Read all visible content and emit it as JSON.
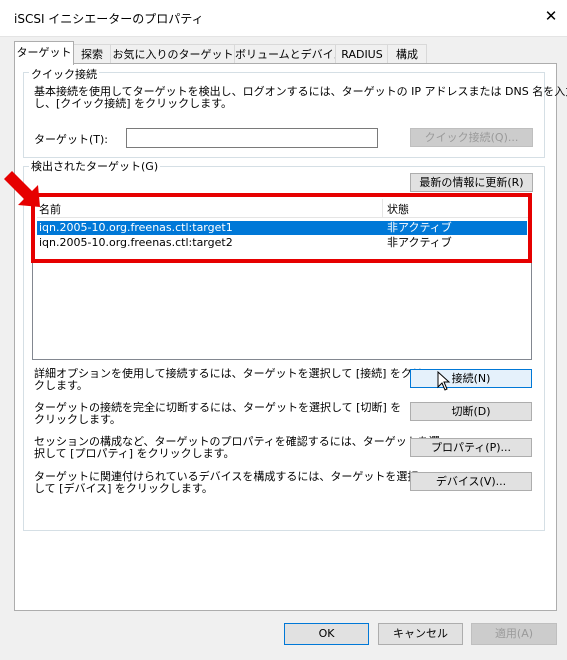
{
  "window": {
    "title": "iSCSI イニシエーターのプロパティ",
    "close_glyph": "✕"
  },
  "tabs": [
    {
      "label": "ターゲット"
    },
    {
      "label": "探索"
    },
    {
      "label": "お気に入りのターゲット"
    },
    {
      "label": "ボリュームとデバイス"
    },
    {
      "label": "RADIUS"
    },
    {
      "label": "構成"
    }
  ],
  "quick_connect": {
    "group_label": "クイック接続",
    "description_line1": "基本接続を使用してターゲットを検出し、ログオンするには、ターゲットの IP アドレスまたは DNS 名を入力",
    "description_line2": "し、[クイック接続] をクリックします。",
    "target_label": "ターゲット(T):",
    "target_value": "",
    "button_label": "クイック接続(Q)..."
  },
  "discovered": {
    "group_label": "検出されたターゲット(G)",
    "refresh_label": "最新の情報に更新(R)",
    "columns": {
      "name": "名前",
      "status": "状態"
    },
    "rows": [
      {
        "name": "iqn.2005-10.org.freenas.ctl:target1",
        "status": "非アクティブ"
      },
      {
        "name": "iqn.2005-10.org.freenas.ctl:target2",
        "status": "非アクティブ"
      }
    ]
  },
  "actions": [
    {
      "line1": "詳細オプションを使用して接続するには、ターゲットを選択して [接続] をクリッ",
      "line2": "クします。",
      "button": "接続(N)"
    },
    {
      "line1": "ターゲットの接続を完全に切断するには、ターゲットを選択して [切断] を",
      "line2": "クリックします。",
      "button": "切断(D)"
    },
    {
      "line1": "セッションの構成など、ターゲットのプロパティを確認するには、ターゲットを選",
      "line2": "択して [プロパティ] をクリックします。",
      "button": "プロパティ(P)..."
    },
    {
      "line1": "ターゲットに関連付けられているデバイスを構成するには、ターゲットを選択",
      "line2": "して [デバイス] をクリックします。",
      "button": "デバイス(V)..."
    }
  ],
  "footer": {
    "ok": "OK",
    "cancel": "キャンセル",
    "apply": "適用(A)"
  },
  "colors": {
    "highlight_box": "#e60000",
    "selection": "#0078d7",
    "arrow": "#e60000"
  },
  "icons": {
    "annotation_arrow": "red-arrow-icon",
    "cursor": "mouse-pointer-icon"
  }
}
